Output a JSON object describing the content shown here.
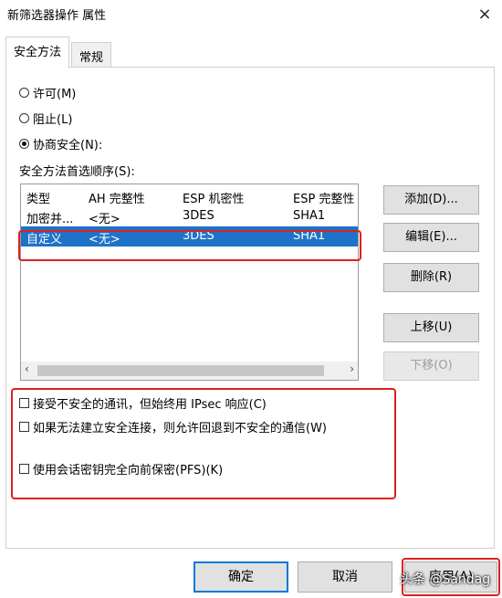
{
  "window": {
    "title": "新筛选器操作 属性",
    "close_label": "×"
  },
  "tabs": [
    {
      "label": "安全方法",
      "active": true
    },
    {
      "label": "常规",
      "active": false
    }
  ],
  "radios": [
    {
      "label": "许可(M)",
      "checked": false
    },
    {
      "label": "阻止(L)",
      "checked": false
    },
    {
      "label": "协商安全(N):",
      "checked": true
    }
  ],
  "methods": {
    "label": "安全方法首选顺序(S):",
    "columns": [
      "类型",
      "AH 完整性",
      "ESP 机密性",
      "ESP 完整性"
    ],
    "rows": [
      [
        "加密并...",
        "<无>",
        "3DES",
        "SHA1"
      ],
      [
        "自定义",
        "<无>",
        "3DES",
        "SHA1"
      ]
    ],
    "selected_row": 1,
    "scroll_left": "‹",
    "scroll_right": "›"
  },
  "side_buttons": {
    "add": "添加(D)...",
    "edit": "编辑(E)...",
    "delete": "删除(R)",
    "move_up": "上移(U)",
    "move_down": "下移(O)"
  },
  "checkboxes": [
    {
      "label": "接受不安全的通讯，但始终用 IPsec 响应(C)",
      "checked": false
    },
    {
      "label": "如果无法建立安全连接，则允许回退到不安全的通信(W)",
      "checked": false
    },
    {
      "label": "使用会话密钥完全向前保密(PFS)(K)",
      "checked": false
    }
  ],
  "footer": {
    "ok": "确定",
    "cancel": "取消",
    "apply": "应用(A)",
    "watermark": "头条 @Sandag"
  },
  "colors": {
    "selection": "#1e73c8",
    "highlight": "#e02020"
  }
}
